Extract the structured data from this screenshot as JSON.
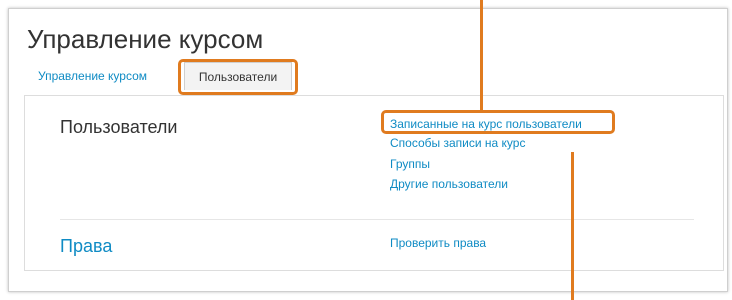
{
  "page": {
    "title": "Управление курсом"
  },
  "tabs": [
    {
      "label": "Управление курсом",
      "active": false
    },
    {
      "label": "Пользователи",
      "active": true
    }
  ],
  "sections": {
    "users": {
      "heading": "Пользователи",
      "links": [
        {
          "label": "Записанные на курс пользователи",
          "highlighted": true
        },
        {
          "label": "Способы записи на курс"
        },
        {
          "label": "Группы"
        },
        {
          "label": "Другие пользователи"
        }
      ]
    },
    "rights": {
      "heading": "Права",
      "links": [
        {
          "label": "Проверить права"
        }
      ]
    }
  },
  "colors": {
    "link": "#0f8bc4",
    "text": "#333333",
    "annotation": "#e07b1f",
    "tab_active_bg": "#f3f3f3",
    "border": "#dddddd"
  }
}
